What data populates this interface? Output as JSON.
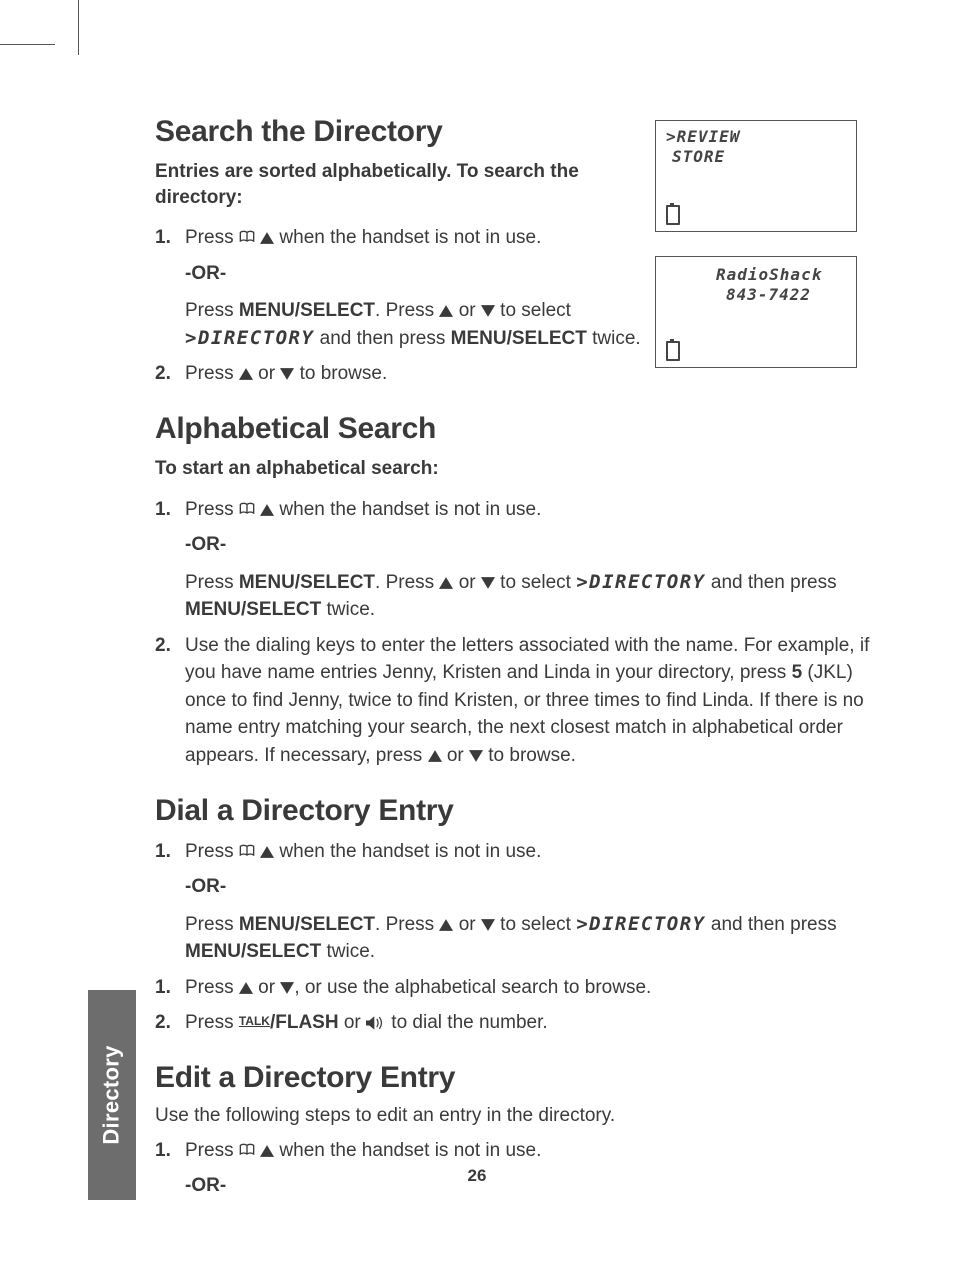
{
  "page_number": "26",
  "side_tab": "Directory",
  "screens": {
    "a": {
      "line1": ">REVIEW",
      "line2": "STORE"
    },
    "b": {
      "line1": "RadioShack",
      "line2": "843-7422"
    }
  },
  "s1": {
    "heading": "Search the Directory",
    "intro": "Entries are sorted alphabetically. To search the directory:",
    "step1_num": "1.",
    "step1_a": "Press ",
    "step1_b": " when the handset is not in use.",
    "or": "-OR-",
    "step1_c1": "Press ",
    "step1_c2": "MENU/SELECT",
    "step1_c3": ". Press ",
    "step1_c4": " or ",
    "step1_c5": "  to select ",
    "step1_dir": ">DIRECTORY",
    "step1_c6": " and then press ",
    "step1_c7": "MENU/SELECT",
    "step1_c8": " twice.",
    "step2_num": "2.",
    "step2_a": "Press ",
    "step2_b": " or ",
    "step2_c": " to browse."
  },
  "s2": {
    "heading": "Alphabetical Search",
    "intro": "To start an alphabetical search:",
    "step1_num": "1.",
    "step1_a": "Press ",
    "step1_b": " when the handset is not in use.",
    "or": "-OR-",
    "step1_c1": "Press ",
    "step1_c2": "MENU/SELECT",
    "step1_c3": ". Press ",
    "step1_c4": " or ",
    "step1_c5": "  to select ",
    "step1_dir": ">DIRECTORY",
    "step1_c6": " and then press ",
    "step1_c7": "MENU/SELECT",
    "step1_c8": " twice.",
    "step2_num": "2.",
    "step2_a": "Use the dialing keys to enter the letters associated with the name. For example, if you have name entries Jenny, Kristen and Linda in your directory, press ",
    "step2_key": "5",
    "step2_b": " (JKL) once to find Jenny, twice to find Kristen, or three times to find Linda. If there is no name entry matching your search, the next closest match in alphabetical order appears. If necessary, press ",
    "step2_c": " or ",
    "step2_d": " to browse."
  },
  "s3": {
    "heading": "Dial a Directory Entry",
    "step1_num": "1.",
    "step1_a": "Press ",
    "step1_b": " when the handset is not in use.",
    "or": "-OR-",
    "sub_c1": "Press ",
    "sub_c2": "MENU/SELECT",
    "sub_c3": ". Press ",
    "sub_c4": " or ",
    "sub_c5": "  to select ",
    "sub_dir": ">DIRECTORY",
    "sub_c6": " and then press ",
    "sub_c7": "MENU/SELECT",
    "sub_c8": " twice.",
    "step1b_num": "1.",
    "step1b_a": "Press ",
    "step1b_b": " or ",
    "step1b_c": ", or use the alphabetical search to browse.",
    "step2_num": "2.",
    "step2_a": "Press ",
    "step2_talk": "TALK",
    "step2_flash": "/FLASH",
    "step2_b": " or ",
    "step2_c": " to dial the number."
  },
  "s4": {
    "heading": "Edit a Directory Entry",
    "intro": "Use the following steps to edit an entry in the directory.",
    "step1_num": "1.",
    "step1_a": "Press ",
    "step1_b": " when the handset is not in use.",
    "or": "-OR-"
  }
}
